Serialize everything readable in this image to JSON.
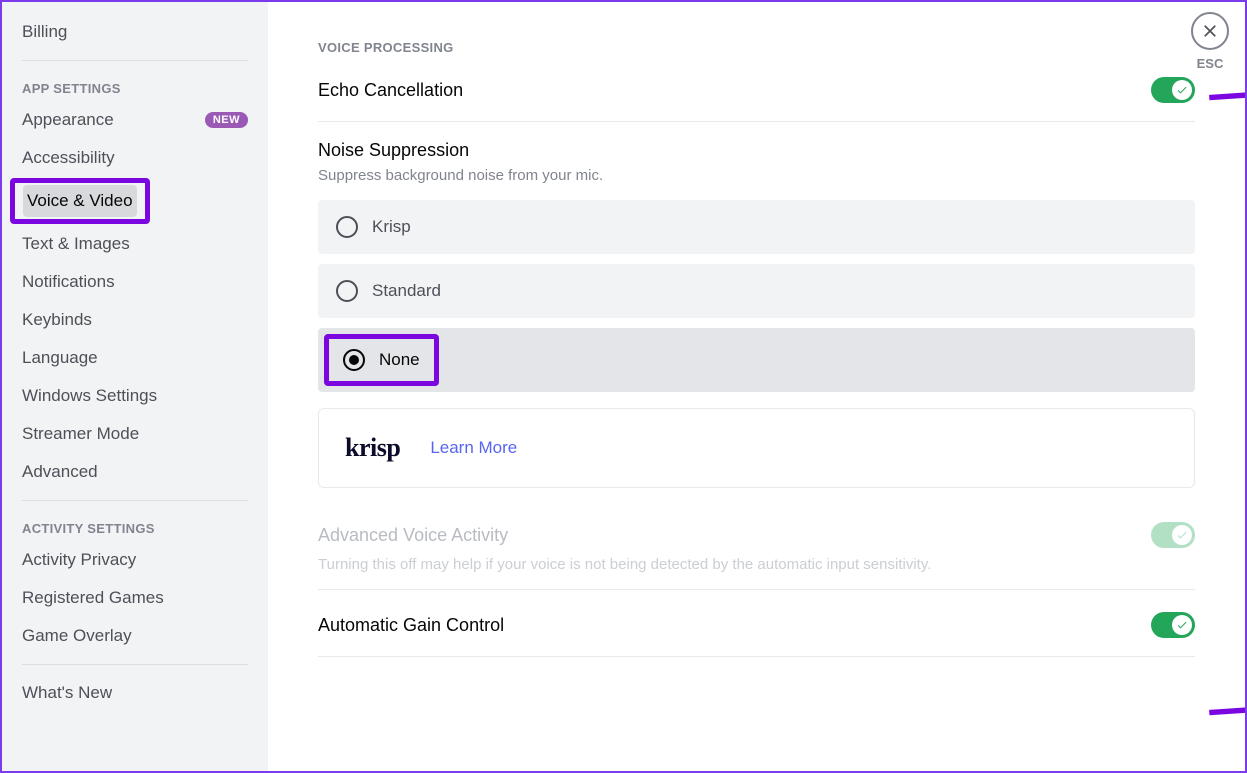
{
  "sidebar": {
    "items_top": [
      {
        "label": "Billing"
      }
    ],
    "heading_app": "APP SETTINGS",
    "app_items": [
      {
        "label": "Appearance",
        "badge": "NEW"
      },
      {
        "label": "Accessibility"
      },
      {
        "label": "Voice & Video",
        "active": true,
        "highlighted": true
      },
      {
        "label": "Text & Images"
      },
      {
        "label": "Notifications"
      },
      {
        "label": "Keybinds"
      },
      {
        "label": "Language"
      },
      {
        "label": "Windows Settings"
      },
      {
        "label": "Streamer Mode"
      },
      {
        "label": "Advanced"
      }
    ],
    "heading_activity": "ACTIVITY SETTINGS",
    "activity_items": [
      {
        "label": "Activity Privacy"
      },
      {
        "label": "Registered Games"
      },
      {
        "label": "Game Overlay"
      }
    ],
    "items_bottom": [
      {
        "label": "What's New"
      }
    ]
  },
  "close": {
    "esc": "ESC"
  },
  "content": {
    "section_heading": "VOICE PROCESSING",
    "echo": {
      "title": "Echo Cancellation",
      "enabled": true
    },
    "noise": {
      "title": "Noise Suppression",
      "desc": "Suppress background noise from your mic.",
      "options": [
        {
          "label": "Krisp",
          "selected": false
        },
        {
          "label": "Standard",
          "selected": false
        },
        {
          "label": "None",
          "selected": true,
          "highlighted": true
        }
      ]
    },
    "krisp": {
      "logo": "krisp",
      "link": "Learn More"
    },
    "advanced_voice": {
      "title": "Advanced Voice Activity",
      "desc": "Turning this off may help if your voice is not being detected by the automatic input sensitivity.",
      "enabled": true,
      "disabled_ui": true
    },
    "agc": {
      "title": "Automatic Gain Control",
      "enabled": true
    }
  }
}
